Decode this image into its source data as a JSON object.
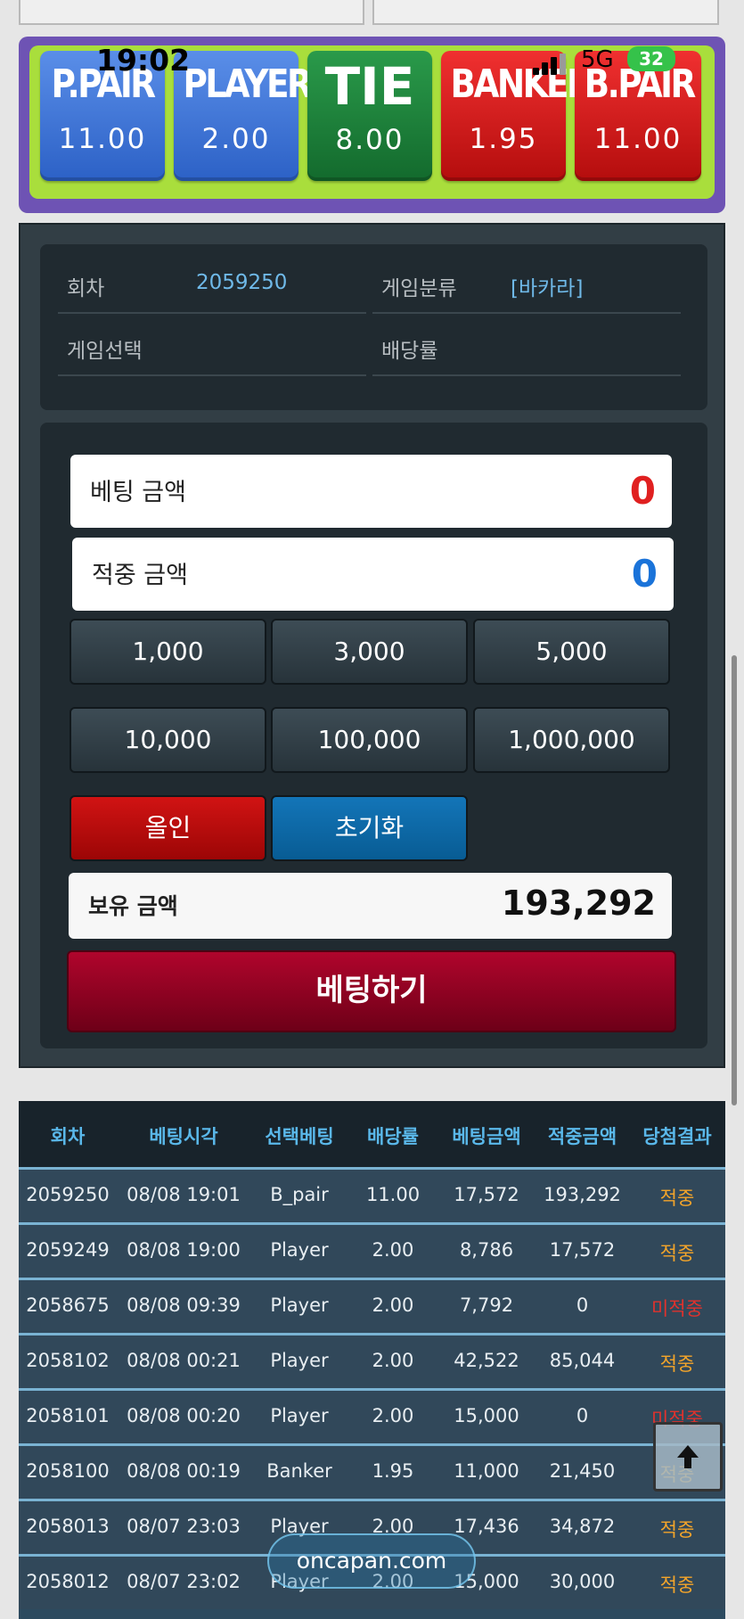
{
  "status_bar": {
    "time": "19:02",
    "network": "5G",
    "battery": "32"
  },
  "bet_options": [
    {
      "label": "P.PAIR",
      "odds": "11.00",
      "color": "#3d74d6"
    },
    {
      "label": "PLAYER",
      "odds": "2.00",
      "color": "#3d74d6"
    },
    {
      "label": "TIE",
      "odds": "8.00",
      "color": "#178038"
    },
    {
      "label": "BANKER",
      "odds": "1.95",
      "color": "#d61414"
    },
    {
      "label": "B.PAIR",
      "odds": "11.00",
      "color": "#d61414"
    }
  ],
  "round_info": {
    "round_label": "회차",
    "round_value": "2059250",
    "category_label": "게임분류",
    "category_value": "[바카라]",
    "selection_label": "게임선택",
    "odds_label": "배당률"
  },
  "bet_form": {
    "bet_amount_label": "베팅 금액",
    "bet_amount_value": "0",
    "win_amount_label": "적중 금액",
    "win_amount_value": "0",
    "chips": [
      "1,000",
      "3,000",
      "5,000",
      "10,000",
      "100,000",
      "1,000,000"
    ],
    "all_in_label": "올인",
    "reset_label": "초기화",
    "balance_label": "보유 금액",
    "balance_value": "193,292",
    "submit_label": "베팅하기"
  },
  "history": {
    "columns": [
      "회차",
      "베팅시각",
      "선택베팅",
      "배당률",
      "베팅금액",
      "적중금액",
      "당첨결과"
    ],
    "rows": [
      [
        "2059250",
        "08/08 19:01",
        "B_pair",
        "11.00",
        "17,572",
        "193,292",
        "적중"
      ],
      [
        "2059249",
        "08/08 19:00",
        "Player",
        "2.00",
        "8,786",
        "17,572",
        "적중"
      ],
      [
        "2058675",
        "08/08 09:39",
        "Player",
        "2.00",
        "7,792",
        "0",
        "미적중"
      ],
      [
        "2058102",
        "08/08 00:21",
        "Player",
        "2.00",
        "42,522",
        "85,044",
        "적중"
      ],
      [
        "2058101",
        "08/08 00:20",
        "Player",
        "2.00",
        "15,000",
        "0",
        "미적중"
      ],
      [
        "2058100",
        "08/08 00:19",
        "Banker",
        "1.95",
        "11,000",
        "21,450",
        "적중"
      ],
      [
        "2058013",
        "08/07 23:03",
        "Player",
        "2.00",
        "17,436",
        "34,872",
        "적중"
      ],
      [
        "2058012",
        "08/07 23:02",
        "Player",
        "2.00",
        "15,000",
        "30,000",
        "적중"
      ]
    ]
  },
  "watermark": "oncapan.com",
  "colors": {
    "hit": "#f4a52a",
    "miss": "#e0322d",
    "bet_amount": "#e02020",
    "win_amount": "#1a73d9"
  }
}
